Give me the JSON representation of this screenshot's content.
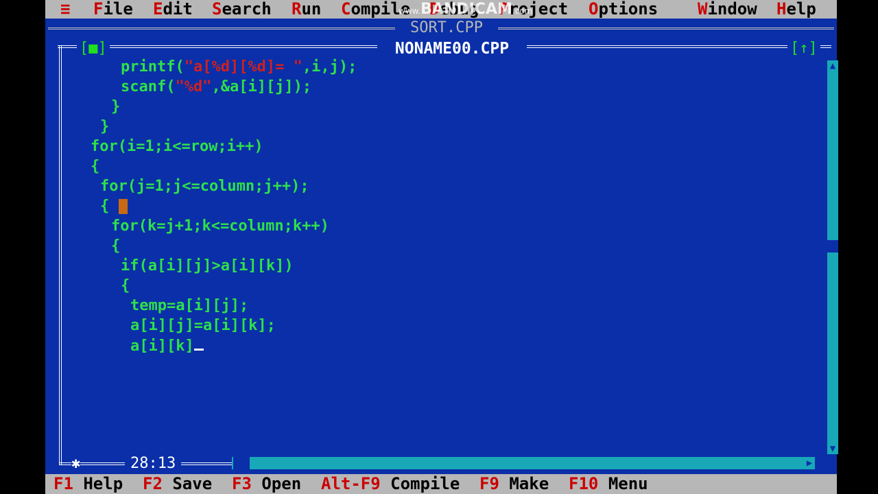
{
  "menu": {
    "system_icon": "≡",
    "items": [
      {
        "hotkey": "F",
        "rest": "ile"
      },
      {
        "hotkey": "E",
        "rest": "dit"
      },
      {
        "hotkey": "S",
        "rest": "earch"
      },
      {
        "hotkey": "R",
        "rest": "un"
      },
      {
        "hotkey": "C",
        "rest": "ompile"
      },
      {
        "hotkey": "D",
        "rest": "ebug"
      },
      {
        "hotkey": "P",
        "rest": "roject"
      },
      {
        "hotkey": "O",
        "rest": "ptions"
      },
      {
        "hotkey": "W",
        "rest": "indow"
      },
      {
        "hotkey": "H",
        "rest": "elp"
      }
    ]
  },
  "watermark": {
    "prefix": "www.",
    "brand": "BANDICAM",
    "suffix": ".com"
  },
  "background_window": {
    "title": "SORT.CPP"
  },
  "editor": {
    "title": "NONAME00.CPP",
    "close_box": "[■]",
    "zoom_box": "[↑]",
    "position": "28:13",
    "modified_marker": "✱",
    "lines": [
      {
        "indent": 3,
        "parts": [
          {
            "t": "printf(",
            "c": "kw"
          },
          {
            "t": "\"a[%d][%d]= \"",
            "c": "str"
          },
          {
            "t": ",i,j);",
            "c": "kw"
          }
        ]
      },
      {
        "indent": 3,
        "parts": [
          {
            "t": "scanf(",
            "c": "kw"
          },
          {
            "t": "\"%d\"",
            "c": "str"
          },
          {
            "t": ",&a[i][j]);",
            "c": "kw"
          }
        ]
      },
      {
        "indent": 2,
        "parts": [
          {
            "t": "}",
            "c": "kw"
          }
        ]
      },
      {
        "indent": 1,
        "parts": [
          {
            "t": "}",
            "c": "kw"
          }
        ]
      },
      {
        "indent": 0,
        "parts": [
          {
            "t": "for(i=1;i<=row;i++)",
            "c": "kw"
          }
        ]
      },
      {
        "indent": 0,
        "parts": [
          {
            "t": "{",
            "c": "kw"
          }
        ]
      },
      {
        "indent": 1,
        "parts": [
          {
            "t": "for(j=1;j<=column;j++);",
            "c": "kw"
          }
        ]
      },
      {
        "indent": 1,
        "parts": [
          {
            "t": "{ ",
            "c": "kw"
          }
        ],
        "block_cursor": true
      },
      {
        "indent": 2,
        "parts": [
          {
            "t": "for(k=j+1;k<=column;k++)",
            "c": "kw"
          }
        ]
      },
      {
        "indent": 2,
        "parts": [
          {
            "t": "{",
            "c": "kw"
          }
        ]
      },
      {
        "indent": 3,
        "parts": [
          {
            "t": "if(a[i][j]>a[i][k])",
            "c": "kw"
          }
        ]
      },
      {
        "indent": 3,
        "parts": [
          {
            "t": "{",
            "c": "kw"
          }
        ]
      },
      {
        "indent": 4,
        "parts": [
          {
            "t": "temp=a[i][j];",
            "c": "kw"
          }
        ]
      },
      {
        "indent": 4,
        "parts": [
          {
            "t": "a[i][j]=a[i][k];",
            "c": "kw"
          }
        ]
      },
      {
        "indent": 4,
        "parts": [
          {
            "t": "a[i][k]",
            "c": "kw"
          }
        ],
        "caret": true
      }
    ]
  },
  "status": [
    {
      "key": "F1",
      "label": "Help"
    },
    {
      "key": "F2",
      "label": "Save"
    },
    {
      "key": "F3",
      "label": "Open"
    },
    {
      "key": "Alt-F9",
      "label": "Compile"
    },
    {
      "key": "F9",
      "label": "Make"
    },
    {
      "key": "F10",
      "label": "Menu"
    }
  ],
  "colors": {
    "background": "#0a2fa8",
    "menu": "#b7b7b7",
    "hotkey": "#c00000",
    "scrollbar": "#18a8b8"
  }
}
